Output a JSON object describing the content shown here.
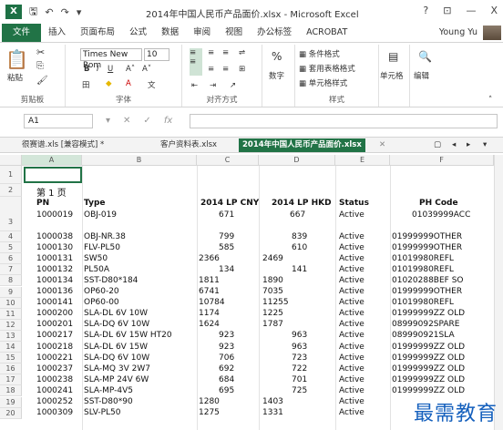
{
  "titlebar": {
    "app_icon": "X",
    "title": "2014年中国人民币产品面价.xlsx - Microsoft Excel",
    "help": "?",
    "restore": "⊡",
    "minimize": "—",
    "close": "X"
  },
  "ribbon_tabs": [
    "文件",
    "插入",
    "页面布局",
    "公式",
    "数据",
    "审阅",
    "视图",
    "办公标签",
    "ACROBAT"
  ],
  "user": "Young Yu",
  "ribbon": {
    "paste": "粘贴",
    "clipboard": "剪贴板",
    "font_name": "Times New Rom",
    "font_size": "10",
    "font_group": "字体",
    "align_group": "对齐方式",
    "number": "数字",
    "cond_format": "条件格式",
    "table_format": "套用表格格式",
    "cell_style": "单元格样式",
    "styles_group": "样式",
    "cells": "单元格",
    "editing": "编辑"
  },
  "formula_bar": {
    "name_box": "A1",
    "fx": "fx"
  },
  "workbook_tabs": [
    "很赛谱.xls [兼容模式] *",
    "客户资料表.xlsx",
    "2014年中国人民币产品面价.xlsx"
  ],
  "columns": [
    "A",
    "B",
    "C",
    "D",
    "E",
    "F"
  ],
  "sheet": {
    "page_label": "第 1 页",
    "headers": {
      "pn": "PN",
      "type": "Type",
      "cny": "2014 LP CNY",
      "hkd": "2014 LP HKD",
      "status": "Status",
      "code": "PH Code"
    },
    "first_row": {
      "row": "",
      "pn": "1000019",
      "type": "OBJ-019",
      "cny": "671",
      "hkd": "667",
      "status": "Active",
      "code": "01039999ACC"
    },
    "rows": [
      {
        "row": "4",
        "pn": "1000038",
        "type": "OBJ-NR.38",
        "cny": "799",
        "hkd": "839",
        "status": "Active",
        "code": "01999999OTHER"
      },
      {
        "row": "5",
        "pn": "1000130",
        "type": "FLV-PL50",
        "cny": "585",
        "hkd": "610",
        "status": "Active",
        "code": "01999999OTHER"
      },
      {
        "row": "6",
        "pn": "1000131",
        "type": "SW50",
        "cny": "2366",
        "hkd": "2469",
        "status": "Active",
        "code": "01019980REFL"
      },
      {
        "row": "7",
        "pn": "1000132",
        "type": "PL50A",
        "cny": "134",
        "hkd": "141",
        "status": "Active",
        "code": "01019980REFL"
      },
      {
        "row": "8",
        "pn": "1000134",
        "type": "SST-D80*184",
        "cny": "1811",
        "hkd": "1890",
        "status": "Active",
        "code": "01020288BEF SO"
      },
      {
        "row": "9",
        "pn": "1000136",
        "type": "OP60-20",
        "cny": "6741",
        "hkd": "7035",
        "status": "Active",
        "code": "01999999OTHER"
      },
      {
        "row": "10",
        "pn": "1000141",
        "type": "OP60-00",
        "cny": "10784",
        "hkd": "11255",
        "status": "Active",
        "code": "01019980REFL"
      },
      {
        "row": "11",
        "pn": "1000200",
        "type": "SLA-DL 6V 10W",
        "cny": "1174",
        "hkd": "1225",
        "status": "Active",
        "code": "01999999ZZ OLD"
      },
      {
        "row": "12",
        "pn": "1000201",
        "type": "SLA-DQ 6V 10W",
        "cny": "1624",
        "hkd": "1787",
        "status": "Active",
        "code": "08999092SPARE"
      },
      {
        "row": "13",
        "pn": "1000217",
        "type": "SLA-DL 6V 15W HT20",
        "cny": "923",
        "hkd": "963",
        "status": "Active",
        "code": "089990921SLA"
      },
      {
        "row": "14",
        "pn": "1000218",
        "type": "SLA-DL 6V 15W",
        "cny": "923",
        "hkd": "963",
        "status": "Active",
        "code": "01999999ZZ OLD"
      },
      {
        "row": "15",
        "pn": "1000221",
        "type": "SLA-DQ 6V 10W",
        "cny": "706",
        "hkd": "723",
        "status": "Active",
        "code": "01999999ZZ OLD"
      },
      {
        "row": "16",
        "pn": "1000237",
        "type": "SLA-MQ 3V 2W7",
        "cny": "692",
        "hkd": "722",
        "status": "Active",
        "code": "01999999ZZ OLD"
      },
      {
        "row": "17",
        "pn": "1000238",
        "type": "SLA-MP 24V 6W",
        "cny": "684",
        "hkd": "701",
        "status": "Active",
        "code": "01999999ZZ OLD"
      },
      {
        "row": "18",
        "pn": "1000241",
        "type": "SLA-MP-4V5",
        "cny": "695",
        "hkd": "725",
        "status": "Active",
        "code": "01999999ZZ OLD"
      },
      {
        "row": "19",
        "pn": "1000252",
        "type": "SST-D80*90",
        "cny": "1280",
        "hkd": "1403",
        "status": "Active",
        "code": ""
      },
      {
        "row": "20",
        "pn": "1000309",
        "type": "SLV-PL50",
        "cny": "1275",
        "hkd": "1331",
        "status": "Active",
        "code": ""
      }
    ]
  },
  "watermark": "最需教育"
}
